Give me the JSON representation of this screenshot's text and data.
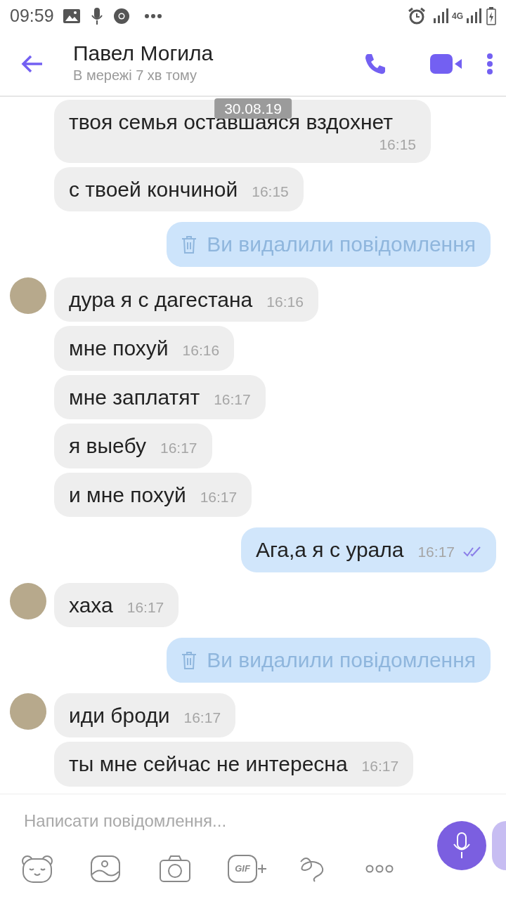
{
  "status_bar": {
    "time": "09:59",
    "network": "4G"
  },
  "header": {
    "contact": "Павел Могила",
    "presence": "В мережі 7 хв тому"
  },
  "date_badge": "30.08.19",
  "messages": [
    {
      "kind": "incoming",
      "avatar": false,
      "text": "твоя семья оставшаяся вздохнет",
      "time": "16:15"
    },
    {
      "kind": "incoming",
      "avatar": false,
      "text": "с твоей кончиной",
      "time": "16:15"
    },
    {
      "kind": "deleted",
      "text": "Ви видалили повідомлення"
    },
    {
      "kind": "incoming",
      "avatar": true,
      "text": "дура я с дагестана",
      "time": "16:16"
    },
    {
      "kind": "incoming",
      "avatar": false,
      "text": "мне похуй",
      "time": "16:16"
    },
    {
      "kind": "incoming",
      "avatar": false,
      "text": "мне заплатят",
      "time": "16:17"
    },
    {
      "kind": "incoming",
      "avatar": false,
      "text": "я выебу",
      "time": "16:17"
    },
    {
      "kind": "incoming",
      "avatar": false,
      "text": "и мне похуй",
      "time": "16:17"
    },
    {
      "kind": "outgoing",
      "text": "Ага,а я с урала",
      "time": "16:17",
      "read": true
    },
    {
      "kind": "incoming",
      "avatar": true,
      "text": "хаха",
      "time": "16:17"
    },
    {
      "kind": "deleted",
      "text": "Ви видалили повідомлення"
    },
    {
      "kind": "incoming",
      "avatar": true,
      "text": "иди броди",
      "time": "16:17"
    },
    {
      "kind": "incoming",
      "avatar": false,
      "text": "ты мне сейчас не интересна",
      "time": "16:17"
    }
  ],
  "composer": {
    "placeholder": "Написати повідомлення...",
    "gif_label": "GIF"
  }
}
